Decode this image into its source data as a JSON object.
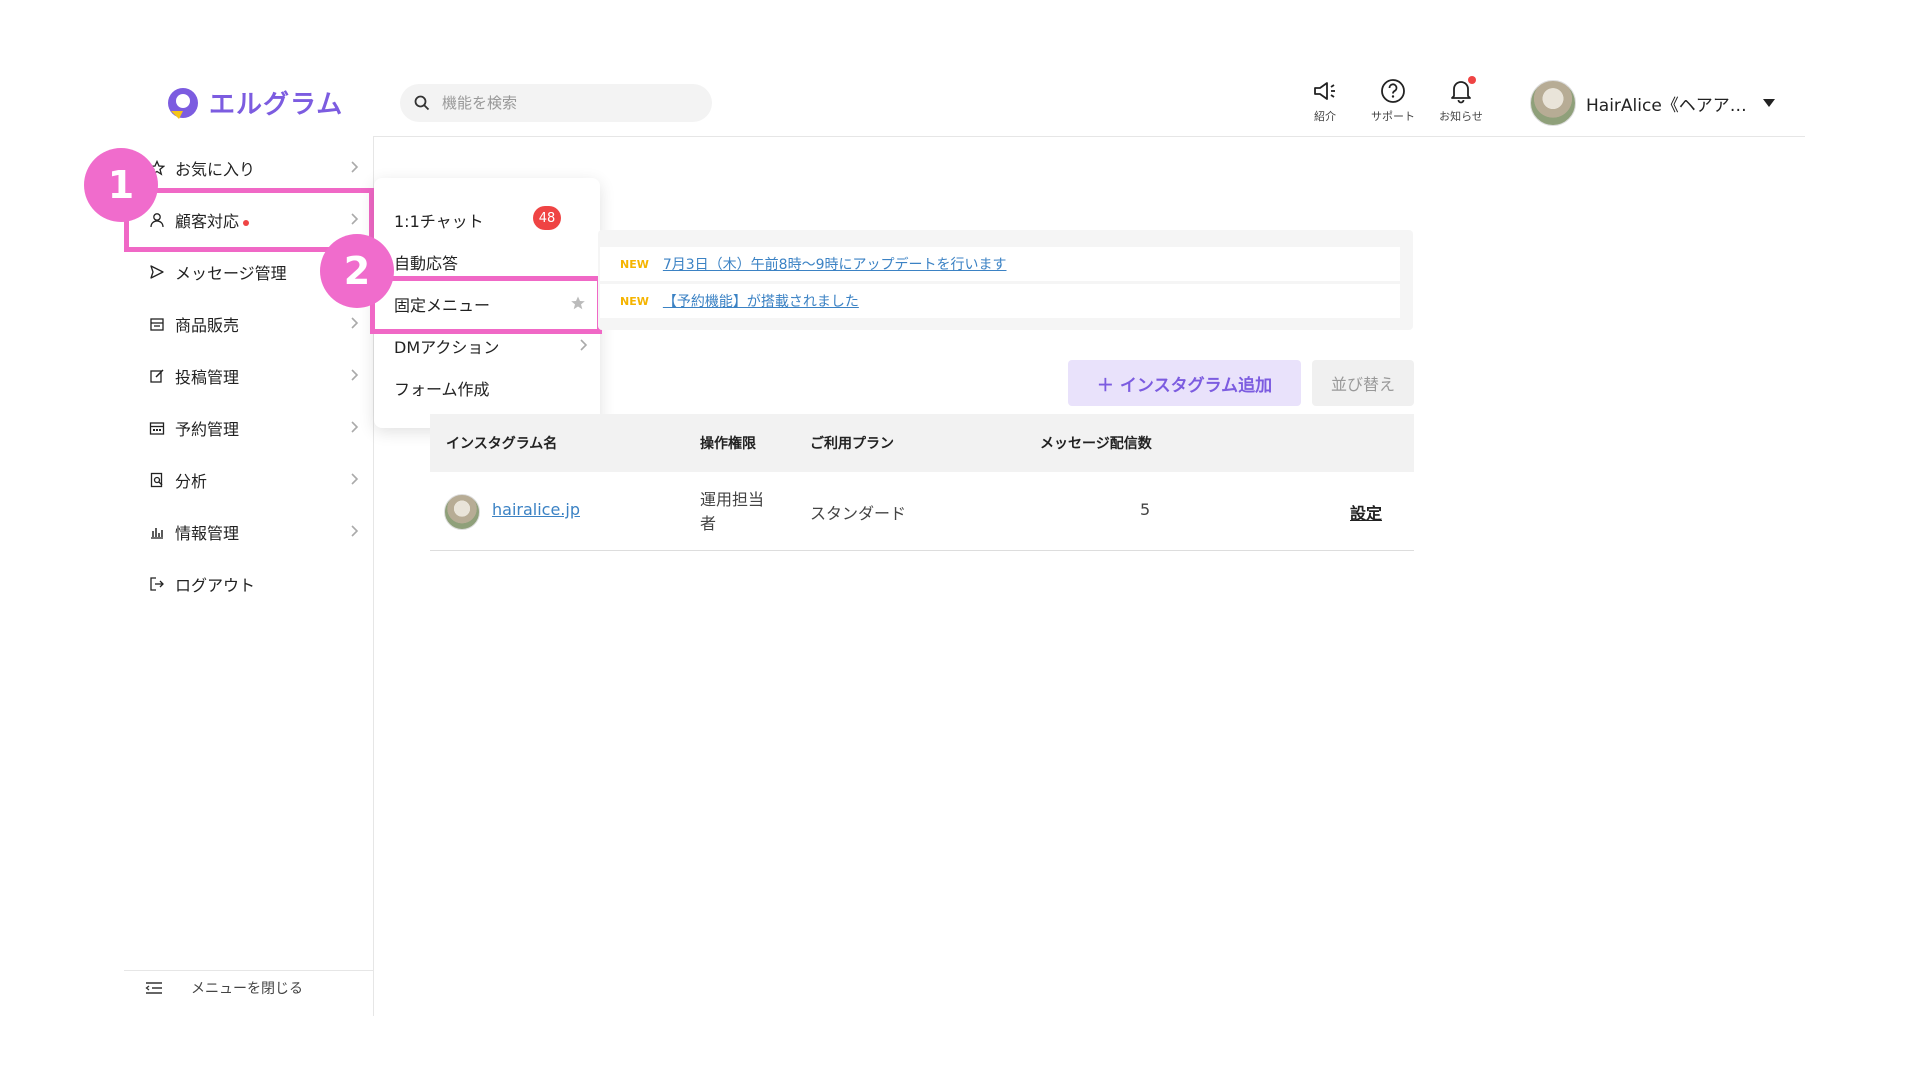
{
  "app": {
    "logo_text": "エルグラム",
    "brand_color": "#7c5ce0",
    "highlight_color": "#f068c6"
  },
  "search": {
    "placeholder": "機能を検索"
  },
  "header": {
    "icons": [
      {
        "name": "megaphone-icon",
        "label": "紹介"
      },
      {
        "name": "help-circle-icon",
        "label": "サポート"
      },
      {
        "name": "bell-icon",
        "label": "お知らせ"
      }
    ],
    "account_name": "HairAlice《ヘアア…"
  },
  "sidebar": {
    "items": [
      {
        "label": "お気に入り",
        "icon": "star-icon"
      },
      {
        "label": "顧客対応",
        "icon": "user-icon"
      },
      {
        "label": "メッセージ管理",
        "icon": "send-icon"
      },
      {
        "label": "商品販売",
        "icon": "store-icon"
      },
      {
        "label": "投稿管理",
        "icon": "edit-icon"
      },
      {
        "label": "予約管理",
        "icon": "calendar-icon"
      },
      {
        "label": "分析",
        "icon": "report-icon"
      },
      {
        "label": "情報管理",
        "icon": "bar-chart-icon"
      },
      {
        "label": "ログアウト",
        "icon": "logout-icon"
      }
    ],
    "collapse_label": "メニューを閉じる"
  },
  "submenu": {
    "items": [
      {
        "label": "1:1チャット",
        "badge": "48"
      },
      {
        "label": "自動応答"
      },
      {
        "label": "固定メニュー"
      },
      {
        "label": "DMアクション"
      },
      {
        "label": "フォーム作成"
      }
    ]
  },
  "steps": {
    "step1": "1",
    "step2": "2"
  },
  "news": [
    {
      "tag": "NEW",
      "text": "7月3日（木）午前8時〜9時にアップデートを行います"
    },
    {
      "tag": "NEW",
      "text": "【予約機能】が搭載されました"
    }
  ],
  "buttons": {
    "add": "インスタグラム追加",
    "sort": "並び替え"
  },
  "table": {
    "headers": [
      "インスタグラム名",
      "操作権限",
      "ご利用プラン",
      "メッセージ配信数"
    ],
    "rows": [
      {
        "account": "hairalice.jp",
        "role": "運用担当者",
        "plan": "スタンダード",
        "count": "5",
        "action": "設定"
      }
    ]
  }
}
